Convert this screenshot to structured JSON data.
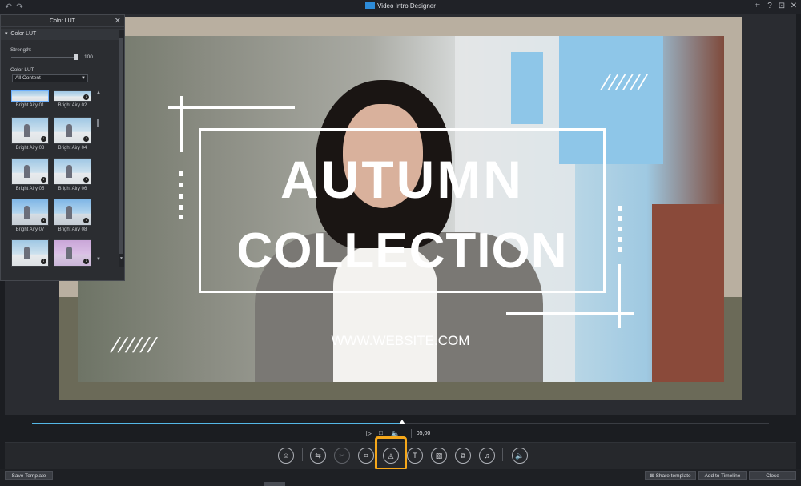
{
  "window": {
    "title": "Video Intro Designer",
    "undo_icon": "↶",
    "redo_icon": "↷",
    "buttons": [
      "⌗",
      "?",
      "⊡",
      "✕"
    ]
  },
  "panel": {
    "title": "Color LUT",
    "section": "Color LUT",
    "strength_label": "Strength:",
    "strength_value": "100",
    "lut_label": "Color LUT",
    "dropdown_value": "All Content",
    "items": [
      "Bright Airy 01",
      "Bright Airy 02",
      "Bright Airy 03",
      "Bright Airy 04",
      "Bright Airy 05",
      "Bright Airy 06",
      "Bright Airy 07",
      "Bright Airy 08"
    ]
  },
  "preview": {
    "headline_1": "AUTUMN",
    "headline_2": "COLLECTION",
    "website": "WWW.WEBSITE.COM",
    "slashes": "//////"
  },
  "playback": {
    "timecode": "05;00",
    "progress": 0.502
  },
  "bottom": {
    "save_template": "Save Template",
    "share_template": "Share template",
    "add_to_timeline": "Add to Timeline",
    "close": "Close"
  },
  "colors": {
    "accent_highlight": "#f5a71a",
    "timeline_progress": "#54b7e6"
  }
}
